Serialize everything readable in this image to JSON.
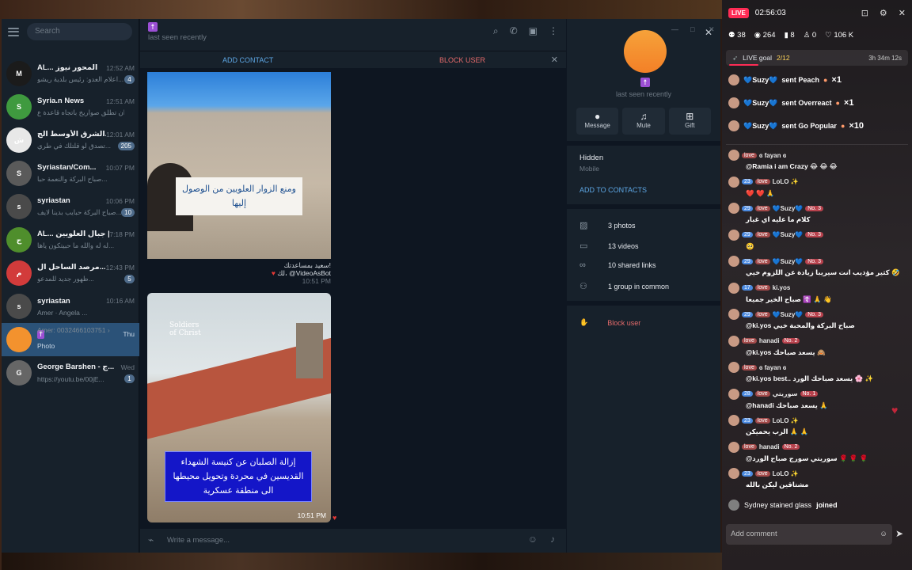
{
  "telegram": {
    "search_placeholder": "Search",
    "chats": [
      {
        "name": "AL... المحور نيوز",
        "time": "12:52 AM",
        "preview": "اعلام العدو: رئيس بلدية ريشو...",
        "badge": "4",
        "avatar_color": "#1b1b1b",
        "avatar_text": "M"
      },
      {
        "name": "Syria.n News",
        "time": "12:51 AM",
        "preview": "إيران تطلق صواريخ باتجاه قاعدة ع...",
        "badge": "",
        "avatar_color": "#3f9a3f",
        "avatar_text": "S"
      },
      {
        "name": "الشرق الأوسط الج...",
        "time": "12:01 AM",
        "preview": "تصدق لو قلتلك في طري...",
        "badge": "205",
        "avatar_color": "#e8e8e8",
        "avatar_text": "ش"
      },
      {
        "name": "Syriastan/Com...",
        "time": "10:07 PM",
        "preview": "صباح البركة والنعمة حبا...",
        "badge": "",
        "avatar_color": "#5a5a5a",
        "avatar_text": "S"
      },
      {
        "name": "syriastan",
        "time": "10:06 PM",
        "preview": "صباح البركة حبايب بدينا لايف...",
        "badge": "10",
        "avatar_color": "#4a4a4a",
        "avatar_text": "s"
      },
      {
        "name": "AL... جبال العلويين |",
        "time": "7:18 PM",
        "preview": "له له والله ما حبيتكون ياها...",
        "badge": "",
        "avatar_color": "#4f8e2c",
        "avatar_text": "ج"
      },
      {
        "name": "مرصد الساحل ال...",
        "time": "12:43 PM",
        "preview": "ظهور جديد للمدعو...",
        "badge": "5",
        "avatar_color": "#d23b3b",
        "avatar_text": "م"
      },
      {
        "name": "syriastan",
        "time": "10:16 AM",
        "preview": "Amer  ·  Angela ...",
        "badge": "",
        "avatar_color": "#4a4a4a",
        "avatar_text": "s"
      },
      {
        "name": "",
        "time": "Thu",
        "preview": "Photo",
        "badge": "",
        "avatar_color": "#f3922e",
        "avatar_text": ""
      },
      {
        "name": "George Barshen - ج...",
        "time": "Wed",
        "preview": "https://youtu.be/00jE...",
        "badge": "1",
        "avatar_color": "#666666",
        "avatar_text": "G"
      }
    ],
    "syriastan_sub": "Amer: 0032466103751 ›",
    "header": {
      "glyph": "☨",
      "last_seen": "last seen recently"
    },
    "action_bar": {
      "add_contact": "ADD CONTACT",
      "block_user": "BLOCK USER"
    },
    "msg1": {
      "caption": "ومنع الزوار العلويين من الوصول إليها",
      "meta_line1": "سعيد بمساعدتك!",
      "meta_line2": "لك، @VideoAsBot",
      "time": "10:51 PM"
    },
    "msg2": {
      "logo": "Soldiers of Christ",
      "caption": "إزالة الصلبان عن كنيسة الشهداء القديسين في محردة وتحويل محيطها الى منطقة عسكرية",
      "time": "10:51 PM"
    },
    "composer_placeholder": "Write a message...",
    "profile": {
      "glyph": "☨",
      "last_seen": "last seen recently",
      "actions": [
        "Message",
        "Mute",
        "Gift"
      ],
      "phone_label": "Hidden",
      "phone_sub": "Mobile",
      "add_to_contacts": "ADD TO CONTACTS",
      "media_rows": [
        "3 photos",
        "13 videos",
        "10 shared links",
        "1 group in common"
      ],
      "block": "Block user"
    }
  },
  "live": {
    "badge": "LIVE",
    "time": "02:56:03",
    "stats": {
      "people": "38",
      "views": "264",
      "saves": "8",
      "follows": "0",
      "likes": "106 K"
    },
    "goal": {
      "label": "LIVE goal",
      "progress": "2/12",
      "progress_fraction": 0.1667,
      "remaining": "3h 34m 12s"
    },
    "gifts": [
      {
        "user": "💙Suzy💙",
        "action": "sent Peach",
        "mult": "×1"
      },
      {
        "user": "💙Suzy💙",
        "action": "sent Overreact",
        "mult": "×1"
      },
      {
        "user": "💙Suzy💙",
        "action": "sent Go Popular",
        "mult": "×10"
      }
    ],
    "comments": [
      {
        "lvl": "",
        "tag": "love",
        "name": "ɞ fayan ɞ",
        "rank": "",
        "text": "@Ramia i am Crazy 😂 😂 😂"
      },
      {
        "lvl": "23",
        "tag": "love",
        "name": "LoLO ✨",
        "rank": "",
        "text": "❤️ ❤️ 🙏"
      },
      {
        "lvl": "29",
        "tag": "love",
        "name": "💙Suzy💙",
        "rank": "No. 3",
        "text": "كلام ما عليه اي غبار"
      },
      {
        "lvl": "29",
        "tag": "love",
        "name": "💙Suzy💙",
        "rank": "No. 3",
        "text": "🥺"
      },
      {
        "lvl": "29",
        "tag": "love",
        "name": "💙Suzy💙",
        "rank": "No. 3",
        "text": "كثير مؤذيب انت سيريبا زيادة عن اللزوم خيي 🤣"
      },
      {
        "lvl": "17",
        "tag": "love",
        "name": "ki.yos",
        "rank": "",
        "text": "صباح الخير جميعا ☦️ 🙏 👋"
      },
      {
        "lvl": "29",
        "tag": "love",
        "name": "💙Suzy💙",
        "rank": "No. 3",
        "text": "@ki.yos صباح البركة والمحبة خيي"
      },
      {
        "lvl": "",
        "tag": "love",
        "name": "hanadi",
        "rank": "No. 2",
        "text": "@ki.yos يسعد صباحك 🙈"
      },
      {
        "lvl": "",
        "tag": "love",
        "name": "ɞ fayan ɞ",
        "rank": "",
        "text": "@ki.yos best.. يسعد صباحك الورد 🌸 ✨"
      },
      {
        "lvl": "28",
        "tag": "love",
        "name": "سوريتي",
        "rank": "No. 1",
        "text": "@hanadi يسعد صباحك 🙏"
      },
      {
        "lvl": "23",
        "tag": "love",
        "name": "LoLO ✨",
        "rank": "",
        "text": "الرب يحميكن 🙏 🙏"
      },
      {
        "lvl": "",
        "tag": "love",
        "name": "hanadi",
        "rank": "No. 2",
        "text": "@سوريتي سورج صباح الورد 🌹 🌹 🌹"
      },
      {
        "lvl": "23",
        "tag": "love",
        "name": "LoLO ✨",
        "rank": "",
        "text": "مشتاقين ليكن بالله"
      }
    ],
    "joined": {
      "name": "Sydney stained glass",
      "action": "joined"
    },
    "comment_placeholder": "Add comment"
  }
}
